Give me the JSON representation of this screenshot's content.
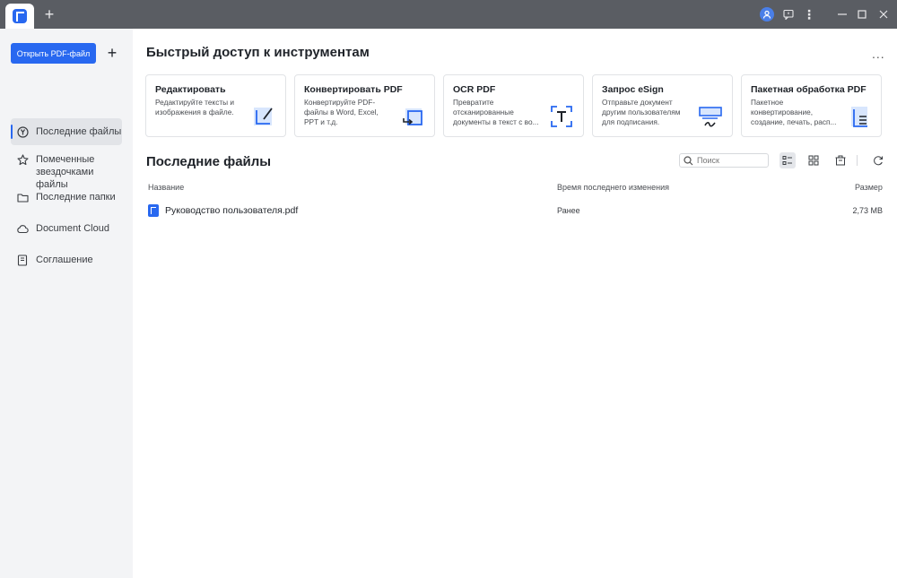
{
  "titlebar": {
    "new_tab_label": "+",
    "menu_label": "⋮"
  },
  "sidebar": {
    "open_button_label": "Открыть PDF-файл",
    "add_button_label": "+",
    "items": [
      {
        "label": "Последние файлы",
        "icon": "recent-icon"
      },
      {
        "label": "Помеченные звездочками файлы",
        "icon": "star-icon"
      },
      {
        "label": "Последние папки",
        "icon": "folder-icon"
      },
      {
        "label": "Document Cloud",
        "icon": "cloud-icon"
      },
      {
        "label": "Соглашение",
        "icon": "document-icon"
      }
    ]
  },
  "quick_access": {
    "title": "Быстрый доступ к инструментам",
    "more_label": "...",
    "cards": [
      {
        "title": "Редактировать",
        "desc": "Редактируйте тексты и изображения в файле.",
        "icon": "edit-icon"
      },
      {
        "title": "Конвертировать PDF",
        "desc": "Конвертируйте PDF-файлы в Word, Excel, PPT и т.д.",
        "icon": "convert-icon"
      },
      {
        "title": "OCR PDF",
        "desc": "Превратите отсканированные документы в текст с во...",
        "icon": "ocr-icon"
      },
      {
        "title": "Запрос eSign",
        "desc": "Отправьте документ другим пользователям для подписания.",
        "icon": "esign-icon"
      },
      {
        "title": "Пакетная обработка PDF",
        "desc": "Пакетное конвертирование, создание, печать, расп...",
        "icon": "batch-icon"
      }
    ]
  },
  "recent_files": {
    "title": "Последние файлы",
    "search_placeholder": "Поиск",
    "columns": {
      "name": "Название",
      "modified": "Время последнего изменения",
      "size": "Размер"
    },
    "rows": [
      {
        "name": "Руководство пользователя.pdf",
        "modified": "Ранее",
        "size": "2,73 MB"
      }
    ]
  },
  "colors": {
    "accent": "#2868f0",
    "titlebar": "#5a5d63",
    "sidebar": "#f3f4f6"
  }
}
